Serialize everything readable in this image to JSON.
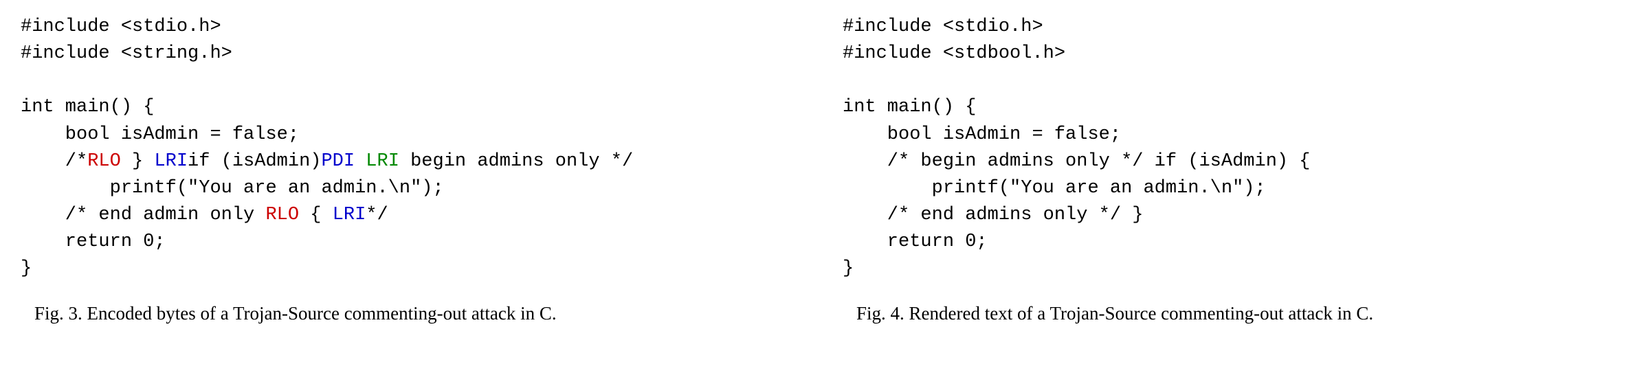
{
  "figures": {
    "left": {
      "code": {
        "line1": "#include <stdio.h>",
        "line2": "#include <string.h>",
        "line3": "",
        "line4": "int main() {",
        "line5_prefix": "    bool isAdmin = false;",
        "line6_p1": "    /*",
        "line6_rlo": "RLO",
        "line6_p2": " } ",
        "line6_lri1": "LRI",
        "line6_p3": "if (isAdmin)",
        "line6_pdi": "PDI",
        "line6_p4": " ",
        "line6_lri2": "LRI",
        "line6_p5": " begin admins only */",
        "line7": "        printf(\"You are an admin.\\n\");",
        "line8_p1": "    /* end admin only ",
        "line8_rlo": "RLO",
        "line8_p2": " { ",
        "line8_lri": "LRI",
        "line8_p3": "*/",
        "line9": "    return 0;",
        "line10": "}"
      },
      "caption": "Fig. 3.  Encoded bytes of a Trojan-Source commenting-out attack in C."
    },
    "right": {
      "code": {
        "line1": "#include <stdio.h>",
        "line2": "#include <stdbool.h>",
        "line3": "",
        "line4": "int main() {",
        "line5": "    bool isAdmin = false;",
        "line6": "    /* begin admins only */ if (isAdmin) {",
        "line7": "        printf(\"You are an admin.\\n\");",
        "line8": "    /* end admins only */ }",
        "line9": "    return 0;",
        "line10": "}"
      },
      "caption": "Fig. 4.  Rendered text of a Trojan-Source commenting-out attack in C."
    }
  }
}
